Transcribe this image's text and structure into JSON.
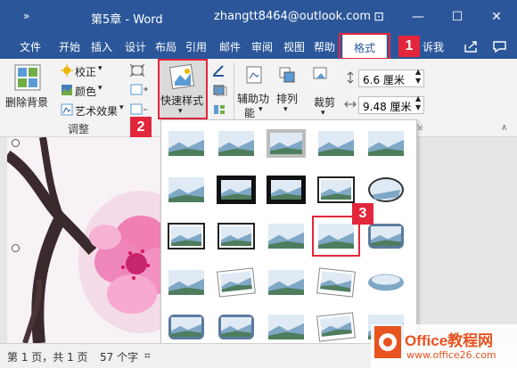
{
  "titlebar": {
    "quick_access": "»",
    "doc_title": "第5章 - Word",
    "user": "zhangtt8464@outlook.com",
    "buttons": [
      "⊡",
      "—",
      "☐",
      "✕"
    ]
  },
  "tabs": [
    "文件",
    "开始",
    "插入",
    "设计",
    "布局",
    "引用",
    "邮件",
    "审阅",
    "视图",
    "帮助",
    "格式",
    "诉我"
  ],
  "badges": {
    "b1": "1",
    "b2": "2",
    "b3": "3"
  },
  "ribbon": {
    "remove_bg": "删除背景",
    "correct": "校正",
    "color": "颜色",
    "artistic": "艺术效果",
    "adjust_group": "调整",
    "quick_styles": "快速样式",
    "helper": [
      "辅助功",
      "能"
    ],
    "arrange": "排列",
    "crop": "裁剪",
    "height": "6.6 厘米",
    "width": "9.48 厘米"
  },
  "status": {
    "page": "第 1 页，共 1 页",
    "words": "57 个字"
  },
  "watermark": {
    "brand": "Office教程网",
    "url": "www.office26.com"
  },
  "colors": {
    "title_blue": "#2b579a",
    "accent_red": "#e2263b",
    "watermark_orange": "#e8531f"
  }
}
